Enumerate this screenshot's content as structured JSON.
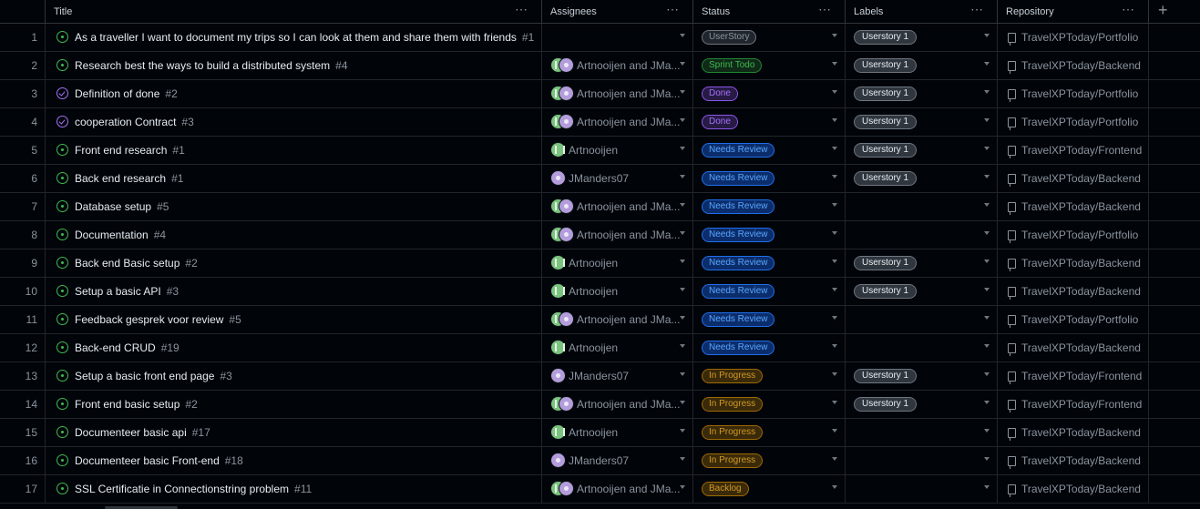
{
  "columns": [
    "Title",
    "Assignees",
    "Status",
    "Labels",
    "Repository"
  ],
  "status_styles": {
    "UserStory": {
      "fg": "#8b949e",
      "bg": "#21262d",
      "border": "#6e7681"
    },
    "Sprint Todo": {
      "fg": "#3fb950",
      "bg": "#0f2a17",
      "border": "#238636"
    },
    "Done": {
      "fg": "#a371f7",
      "bg": "#271a45",
      "border": "#8957e5"
    },
    "Needs Review": {
      "fg": "#58a6ff",
      "bg": "#0c2d6b",
      "border": "#1f6feb"
    },
    "In Progress": {
      "fg": "#d29922",
      "bg": "#3a2a0a",
      "border": "#9e6a03"
    },
    "Backlog": {
      "fg": "#d29922",
      "bg": "#3a2a0a",
      "border": "#9e6a03"
    }
  },
  "rows": [
    {
      "num": "1",
      "state": "open",
      "title": "As a traveller I want to document my trips so I can look at them and share them with friends",
      "issue": "#1",
      "assignees": "",
      "avatars": [],
      "status": "UserStory",
      "label": "Userstory 1",
      "repo": "TravelXPToday/Portfolio"
    },
    {
      "num": "2",
      "state": "open",
      "title": "Research best the ways to build a distributed system",
      "issue": "#4",
      "assignees": "Artnooijen and JMa...",
      "avatars": [
        "green",
        "purple"
      ],
      "status": "Sprint Todo",
      "label": "Userstory 1",
      "repo": "TravelXPToday/Backend"
    },
    {
      "num": "3",
      "state": "done",
      "title": "Definition of done",
      "issue": "#2",
      "assignees": "Artnooijen and JMa...",
      "avatars": [
        "green",
        "purple"
      ],
      "status": "Done",
      "label": "Userstory 1",
      "repo": "TravelXPToday/Portfolio"
    },
    {
      "num": "4",
      "state": "done",
      "title": "cooperation Contract",
      "issue": "#3",
      "assignees": "Artnooijen and JMa...",
      "avatars": [
        "green",
        "purple"
      ],
      "status": "Done",
      "label": "Userstory 1",
      "repo": "TravelXPToday/Portfolio"
    },
    {
      "num": "5",
      "state": "open",
      "title": "Front end research",
      "issue": "#1",
      "assignees": "Artnooijen",
      "avatars": [
        "green"
      ],
      "status": "Needs Review",
      "label": "Userstory 1",
      "repo": "TravelXPToday/Frontend"
    },
    {
      "num": "6",
      "state": "open",
      "title": "Back end research",
      "issue": "#1",
      "assignees": "JManders07",
      "avatars": [
        "purple"
      ],
      "status": "Needs Review",
      "label": "Userstory 1",
      "repo": "TravelXPToday/Backend"
    },
    {
      "num": "7",
      "state": "open",
      "title": "Database setup",
      "issue": "#5",
      "assignees": "Artnooijen and JMa...",
      "avatars": [
        "green",
        "purple"
      ],
      "status": "Needs Review",
      "label": "",
      "repo": "TravelXPToday/Backend"
    },
    {
      "num": "8",
      "state": "open",
      "title": "Documentation",
      "issue": "#4",
      "assignees": "Artnooijen and JMa...",
      "avatars": [
        "green",
        "purple"
      ],
      "status": "Needs Review",
      "label": "",
      "repo": "TravelXPToday/Portfolio"
    },
    {
      "num": "9",
      "state": "open",
      "title": "Back end Basic setup",
      "issue": "#2",
      "assignees": "Artnooijen",
      "avatars": [
        "green"
      ],
      "status": "Needs Review",
      "label": "Userstory 1",
      "repo": "TravelXPToday/Backend"
    },
    {
      "num": "10",
      "state": "open",
      "title": "Setup a basic API",
      "issue": "#3",
      "assignees": "Artnooijen",
      "avatars": [
        "green"
      ],
      "status": "Needs Review",
      "label": "Userstory 1",
      "repo": "TravelXPToday/Backend"
    },
    {
      "num": "11",
      "state": "open",
      "title": "Feedback gesprek voor review",
      "issue": "#5",
      "assignees": "Artnooijen and JMa...",
      "avatars": [
        "green",
        "purple"
      ],
      "status": "Needs Review",
      "label": "",
      "repo": "TravelXPToday/Portfolio"
    },
    {
      "num": "12",
      "state": "open",
      "title": "Back-end CRUD",
      "issue": "#19",
      "assignees": "Artnooijen",
      "avatars": [
        "green"
      ],
      "status": "Needs Review",
      "label": "",
      "repo": "TravelXPToday/Backend"
    },
    {
      "num": "13",
      "state": "open",
      "title": "Setup a basic front end page",
      "issue": "#3",
      "assignees": "JManders07",
      "avatars": [
        "purple"
      ],
      "status": "In Progress",
      "label": "Userstory 1",
      "repo": "TravelXPToday/Frontend"
    },
    {
      "num": "14",
      "state": "open",
      "title": "Front end basic setup",
      "issue": "#2",
      "assignees": "Artnooijen and JMa...",
      "avatars": [
        "green",
        "purple"
      ],
      "status": "In Progress",
      "label": "Userstory 1",
      "repo": "TravelXPToday/Frontend"
    },
    {
      "num": "15",
      "state": "open",
      "title": "Documenteer basic api",
      "issue": "#17",
      "assignees": "Artnooijen",
      "avatars": [
        "green"
      ],
      "status": "In Progress",
      "label": "",
      "repo": "TravelXPToday/Backend"
    },
    {
      "num": "16",
      "state": "open",
      "title": "Documenteer basic Front-end",
      "issue": "#18",
      "assignees": "JManders07",
      "avatars": [
        "purple"
      ],
      "status": "In Progress",
      "label": "",
      "repo": "TravelXPToday/Backend"
    },
    {
      "num": "17",
      "state": "open",
      "title": "SSL Certificatie in Connectionstring problem",
      "issue": "#11",
      "assignees": "Artnooijen and JMa...",
      "avatars": [
        "green",
        "purple"
      ],
      "status": "Backlog",
      "label": "",
      "repo": "TravelXPToday/Backend"
    }
  ]
}
